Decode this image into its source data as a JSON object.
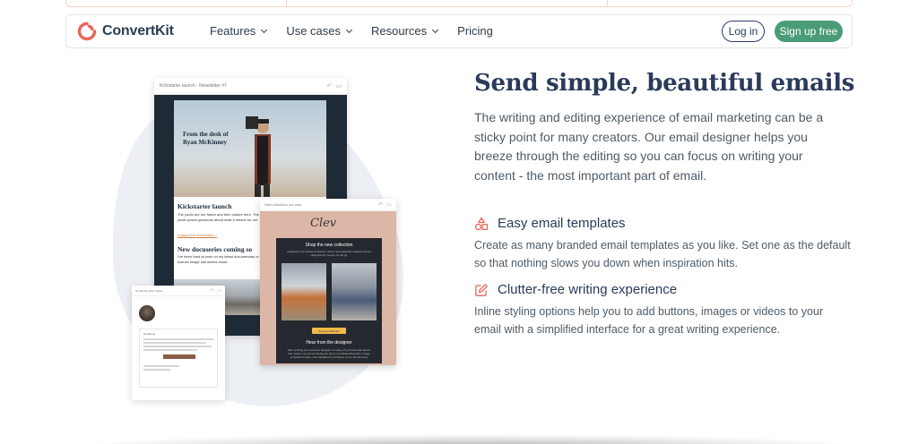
{
  "brand": {
    "name": "ConvertKit",
    "accent": "#e8665a",
    "green": "#4a9c78",
    "navy": "#2a3a6c"
  },
  "nav": {
    "items": [
      {
        "label": "Features",
        "dropdown": true
      },
      {
        "label": "Use cases",
        "dropdown": true
      },
      {
        "label": "Resources",
        "dropdown": true
      },
      {
        "label": "Pricing",
        "dropdown": false
      }
    ],
    "login_label": "Log in",
    "signup_label": "Sign up free"
  },
  "hero": {
    "headline": "Send simple, beautiful emails",
    "intro": "The writing and editing experience of email marketing can be a sticky point for many creators. Our email designer helps you breeze through the editing so you can focus on writing your content - the most important part of email.",
    "features": [
      {
        "icon": "shapes-icon",
        "title": "Easy email templates",
        "body": "Create as many branded email templates as you like. Set one as the default so that nothing slows you down when inspiration hits."
      },
      {
        "icon": "edit-icon",
        "title": "Clutter-free writing experience",
        "body": "Inline styling options help you to add buttons, images or videos to your email with a simplified interface for a great writing experience."
      }
    ]
  },
  "preview": {
    "main_bar": "Kickstarter launch - Newsletter #7",
    "from_desk": "From the desk of",
    "author": "Ryan McKinney",
    "section1_title": "Kickstarter launch",
    "section1_body": "The youth are our future and then culture here. The Kids Are Alright documents current youth poses questions about what it means for our",
    "section1_link": "Support the Kickstarter >",
    "section2_title": "New docuseries coming so",
    "section2_body": "I've been hard at work on my latest documentary or your eyes! Here's a behind-the-scenes image last weeks shoot.",
    "pink_bar": "New collection out now",
    "signature": "Clev",
    "shop_title": "Shop the new collection",
    "shop_sub": "Inspired by the streets of Europe. Clev's new collection features pieces designed for movers on the go",
    "shop_button": "See the collection",
    "hear_title": "Hear from the designer",
    "hear_body": "After working as a costume designer on many of your favourite shows and movies, as well as having the honor of collaborating with a range of fashion brands, Clev delighted to introduce you to the first ever",
    "small_bar": "My Mother Won't Wear",
    "small_greeting": "Hi Hanna,"
  }
}
